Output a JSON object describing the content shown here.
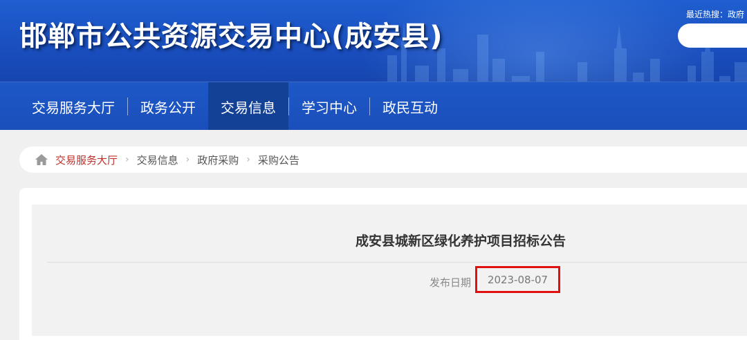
{
  "header": {
    "site_title": "邯郸市公共资源交易中心(成安县)",
    "hot_search_label": "最近热搜：政府",
    "search_placeholder": ""
  },
  "nav": {
    "items": [
      {
        "label": "交易服务大厅"
      },
      {
        "label": "政务公开"
      },
      {
        "label": "交易信息",
        "active": true
      },
      {
        "label": "学习中心"
      },
      {
        "label": "政民互动"
      }
    ]
  },
  "breadcrumb": {
    "icon": "home-icon",
    "items": [
      "交易服务大厅",
      "交易信息",
      "政府采购",
      "采购公告"
    ],
    "separator": "›"
  },
  "article": {
    "title": "成安县城新区绿化养护项目招标公告",
    "publish_label": "发布日期",
    "publish_date": "2023-08-07"
  },
  "colors": {
    "banner_blue": "#1a4fc0",
    "nav_active": "#134196",
    "breadcrumb_active": "#c0302a",
    "highlight_red": "#e01010"
  }
}
